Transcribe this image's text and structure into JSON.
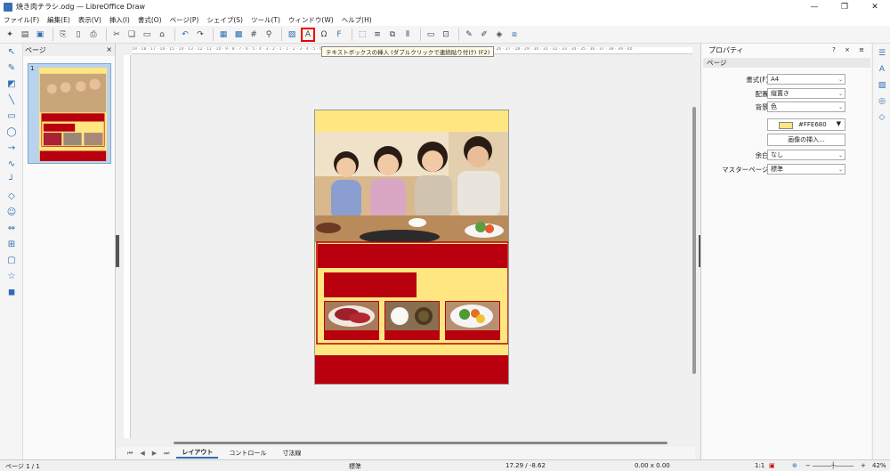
{
  "window": {
    "title": "焼き肉チラシ.odg — LibreOffice Draw",
    "buttons": [
      "—",
      "❐",
      "✕"
    ]
  },
  "menu": [
    "ファイル(F)",
    "編集(E)",
    "表示(V)",
    "挿入(I)",
    "書式(O)",
    "ページ(P)",
    "シェイプ(S)",
    "ツール(T)",
    "ウィンドウ(W)",
    "ヘルプ(H)"
  ],
  "tooltip": "テキストボックスの挿入 (ダブルクリックで連続貼り付け) (F2)",
  "ruler_top": "19 · 18 · 17 · 16 · 15 · 14 · 13 · 12 · 11 · 10 · 9 · 8 · 7 · 6 · 5 · 4 · 3 · 2 · 1 · 1 · 2 · 3 · 4 · 5 · 6 · 7 · 8 · 9 · 10 · 11 · 12 · 13 · 14 · 15 · 16 · 17 · 18 · 19 · 20 · 21 · 22 · 23 · 24 · 25 · 26 · 27 · 28 · 29 · 30 · 31 · 32 · 33 · 34 · 35 · 36 · 37 · 38 · 39 · 40",
  "pages_panel": {
    "title": "ページ",
    "close": "×",
    "page_number": "1"
  },
  "tabs": {
    "nav": [
      "⏮",
      "◀",
      "▶",
      "⏭"
    ],
    "items": [
      "レイアウト",
      "コントロール",
      "寸法線"
    ]
  },
  "sidebar": {
    "title": "プロパティ",
    "header_buttons": "? × ≡",
    "section": "ページ",
    "format_label": "書式(F):",
    "format_value": "A4",
    "orientation_label": "配置:",
    "orientation_value": "縦置き",
    "background_label": "背景:",
    "background_value": "色",
    "color_value": "#FFE680",
    "insert_image": "画像の挿入...",
    "margin_label": "余白:",
    "margin_value": "なし",
    "master_label": "マスターページ:",
    "master_value": "標準"
  },
  "status": {
    "page": "ページ 1 / 1",
    "layout": "標準",
    "position": "17.29 / -8.62",
    "size": "0.00 x 0.00",
    "scale": "1:1",
    "zoom": "42%"
  },
  "colors": {
    "page_bg": "#FFE680",
    "banner_red": "#B8000F",
    "accent": "#2f6db5"
  }
}
